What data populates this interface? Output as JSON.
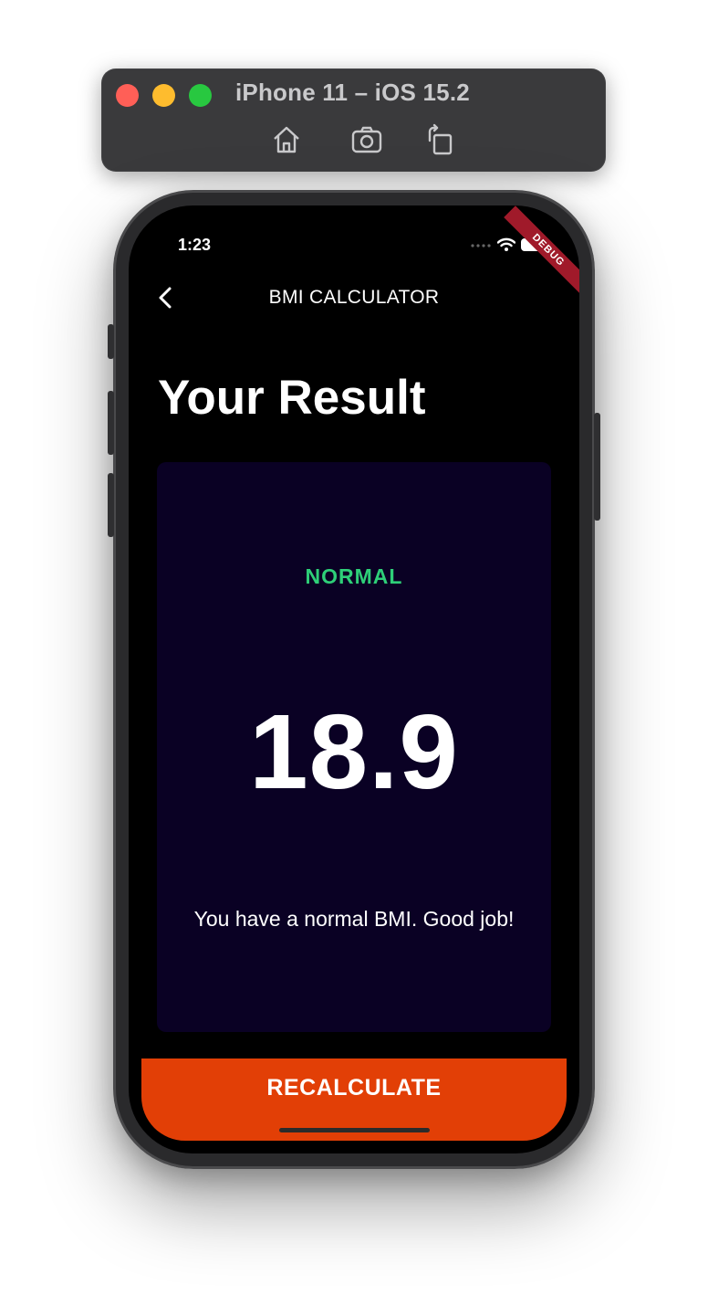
{
  "simulator": {
    "title": "iPhone 11 – iOS 15.2",
    "icons": [
      "home-icon",
      "screenshot-icon",
      "rotate-icon"
    ]
  },
  "status_bar": {
    "time": "1:23",
    "debug_label": "DEBUG"
  },
  "app_bar": {
    "title": "BMI CALCULATOR",
    "back_icon": "chevron-left-icon"
  },
  "page": {
    "title": "Your Result"
  },
  "result": {
    "status": "NORMAL",
    "value": "18.9",
    "message": "You have a normal BMI. Good job!"
  },
  "actions": {
    "recalculate_label": "RECALCULATE"
  },
  "colors": {
    "background": "#000000",
    "card": "#0a0124",
    "status_green": "#2ecf78",
    "button": "#e23f06"
  }
}
